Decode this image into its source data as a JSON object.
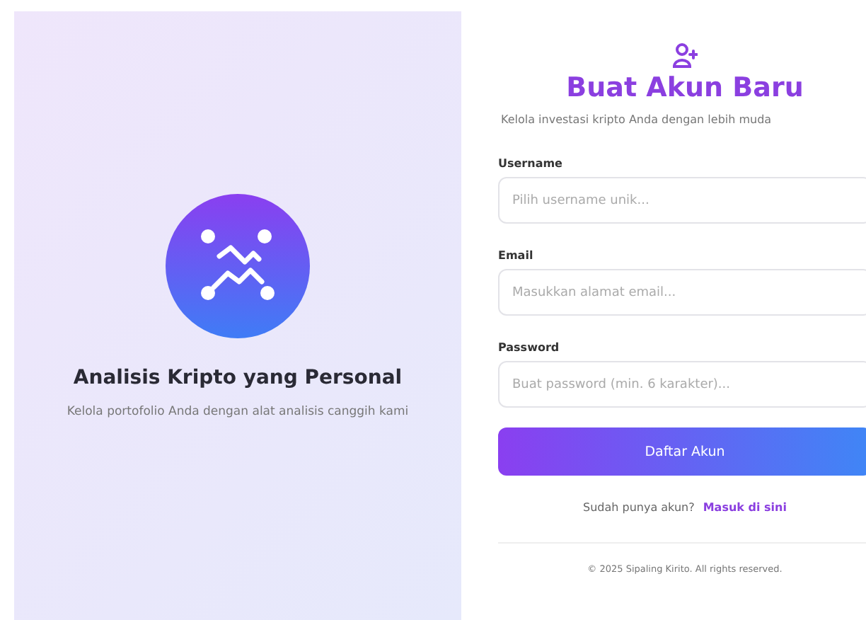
{
  "hero": {
    "title": "Analisis Kripto yang Personal",
    "subtitle": "Kelola portofolio Anda dengan alat analisis canggih kami"
  },
  "form": {
    "title": "Buat Akun Baru",
    "subtitle": "Kelola investasi kripto Anda dengan lebih muda",
    "fields": [
      {
        "label": "Username",
        "placeholder": "Pilih username unik..."
      },
      {
        "label": "Email",
        "placeholder": "Masukkan alamat email..."
      },
      {
        "label": "Password",
        "placeholder": "Buat password (min. 6 karakter)..."
      }
    ],
    "submit": "Daftar Akun",
    "login_prompt": "Sudah punya akun?",
    "login_link": "Masuk di sini"
  },
  "footer": "© 2025 Sipaling Kirito. All rights reserved."
}
